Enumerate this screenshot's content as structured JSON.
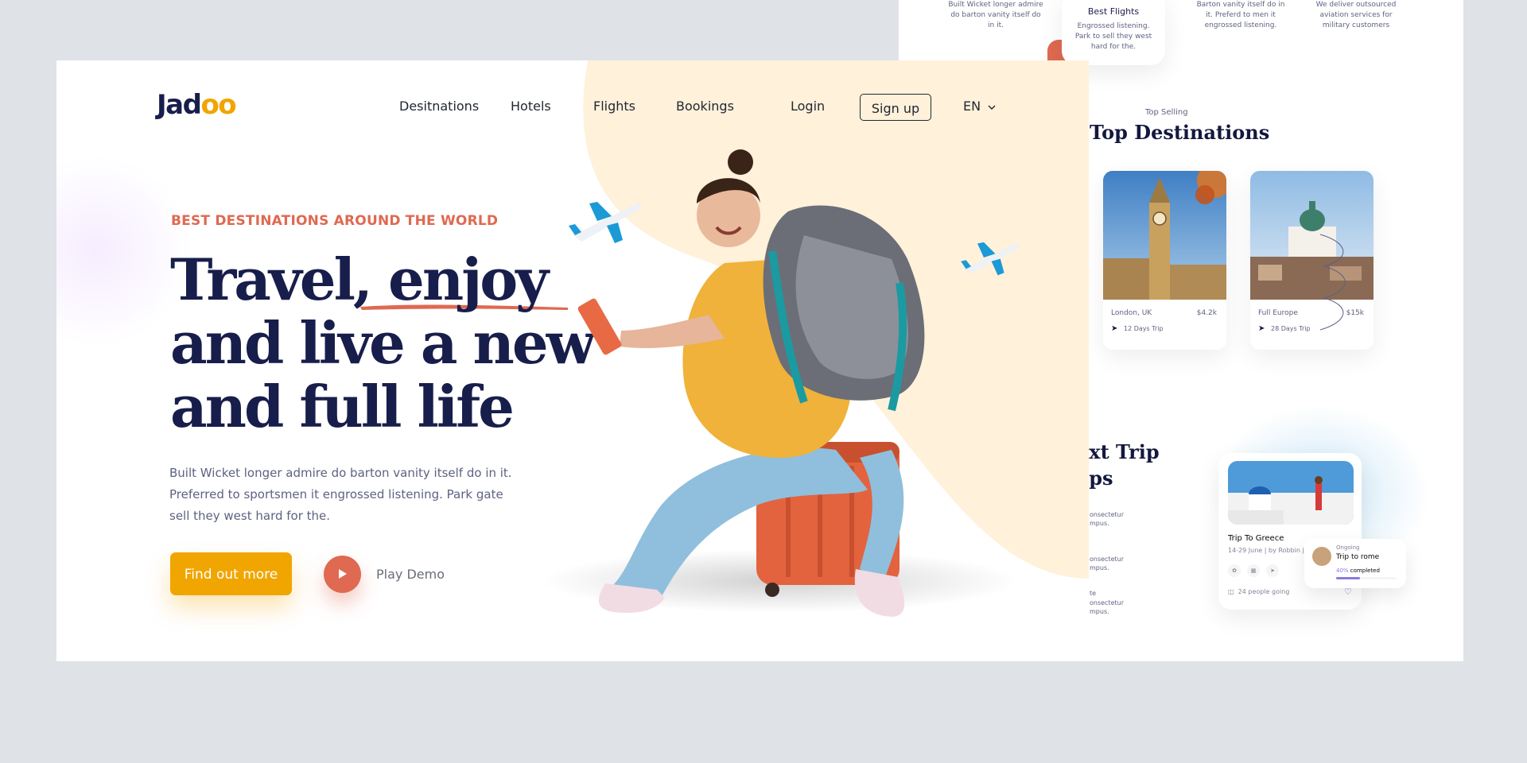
{
  "background_page": {
    "services": [
      {
        "text": "Built Wicket longer admire do barton vanity itself do in it."
      },
      {
        "title": "Best Flights",
        "text": "Engrossed listening. Park to sell they west hard for the."
      },
      {
        "text": "Barton vanity itself do in it. Preferd to men it engrossed listening."
      },
      {
        "text": "We deliver outsourced aviation services for military customers"
      }
    ],
    "top_selling_label": "Top Selling",
    "top_destinations_title": "Top Destinations",
    "destinations": [
      {
        "name": "London, UK",
        "price": "$4.2k",
        "trip": "12 Days Trip"
      },
      {
        "name": "Full Europe",
        "price": "$15k",
        "trip": "28 Days Trip"
      }
    ],
    "next_trip_title_line1": "ext Trip",
    "next_trip_title_line2": "eps",
    "next_trip_lines": [
      "onsectetur",
      "mpus.",
      "onsectetur",
      "mpus.",
      "te",
      "onsectetur",
      "mpus."
    ],
    "trip_card": {
      "title": "Trip To Greece",
      "dates": "14-29 June",
      "by": "by Robbin jo",
      "people": "24 people going"
    },
    "ongoing_card": {
      "label": "Ongoing",
      "name": "Trip to rome",
      "percent": "40%",
      "completed_text": "completed",
      "progress": 0.4
    }
  },
  "brand": {
    "logo_text_a": "Jad",
    "logo_text_b": "oo"
  },
  "nav": {
    "items": [
      "Desitnations",
      "Hotels",
      "Flights",
      "Bookings"
    ],
    "login": "Login",
    "signup": "Sign up",
    "language": "EN"
  },
  "hero": {
    "eyebrow": "BEST DESTINATIONS AROUND THE WORLD",
    "headline_line1": "Travel, enjoy",
    "headline_line2": "and live a new",
    "headline_line3": "and full life",
    "description": "Built Wicket longer admire do barton vanity itself do in it. Preferred to sportsmen it engrossed listening. Park gate sell they west hard for the.",
    "cta_label": "Find out more",
    "play_label": "Play Demo"
  },
  "colors": {
    "navy": "#181e4b",
    "accent_orange": "#df6951",
    "accent_yellow": "#f1a501",
    "cream": "#fff1da",
    "text_gray": "#5e6282"
  },
  "icons": {
    "play": "play-icon",
    "chevron": "chevron-down-icon",
    "plane": "airplane-icon",
    "navigation": "navigation-arrow-icon",
    "heart": "heart-icon"
  }
}
